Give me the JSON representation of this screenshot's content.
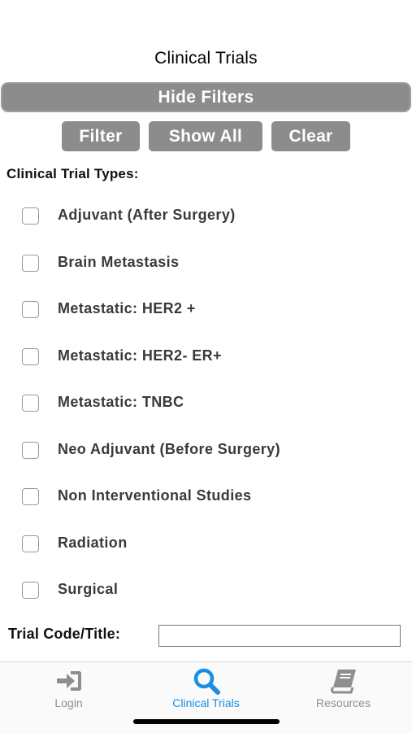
{
  "header": {
    "title": "Clinical Trials"
  },
  "filters": {
    "hide_filters_label": "Hide Filters",
    "buttons": {
      "filter": "Filter",
      "show_all": "Show All",
      "clear": "Clear"
    },
    "types_heading": "Clinical Trial Types:",
    "types": [
      {
        "label": "Adjuvant (After Surgery)",
        "checked": false
      },
      {
        "label": "Brain Metastasis",
        "checked": false
      },
      {
        "label": "Metastatic: HER2 +",
        "checked": false
      },
      {
        "label": "Metastatic: HER2- ER+",
        "checked": false
      },
      {
        "label": "Metastatic: TNBC",
        "checked": false
      },
      {
        "label": "Neo Adjuvant (Before Surgery)",
        "checked": false
      },
      {
        "label": "Non Interventional Studies",
        "checked": false
      },
      {
        "label": "Radiation",
        "checked": false
      },
      {
        "label": "Surgical",
        "checked": false
      }
    ],
    "trial_code": {
      "label": "Trial Code/Title:",
      "value": "",
      "placeholder": ""
    }
  },
  "tabbar": {
    "active": "clinical_trials",
    "accent_color": "#1a8ee6",
    "inactive_color": "#8e8e8e",
    "tabs": [
      {
        "id": "login",
        "label": "Login",
        "icon": "login-icon"
      },
      {
        "id": "clinical_trials",
        "label": "Clinical Trials",
        "icon": "search-icon"
      },
      {
        "id": "resources",
        "label": "Resources",
        "icon": "book-icon"
      }
    ]
  }
}
